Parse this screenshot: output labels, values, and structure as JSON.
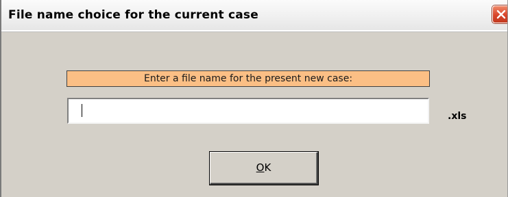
{
  "window": {
    "title": "File name choice for the current case"
  },
  "dialog": {
    "prompt": "Enter a file name for the present new case:",
    "filename_value": "",
    "extension": ".xls",
    "ok_mnemonic": "O",
    "ok_rest": "K"
  },
  "colors": {
    "prompt_bg": "#fbbf85",
    "window_bg": "#d4d0c8",
    "close_button": "#d8442a"
  },
  "icons": {
    "close": "close-icon"
  }
}
